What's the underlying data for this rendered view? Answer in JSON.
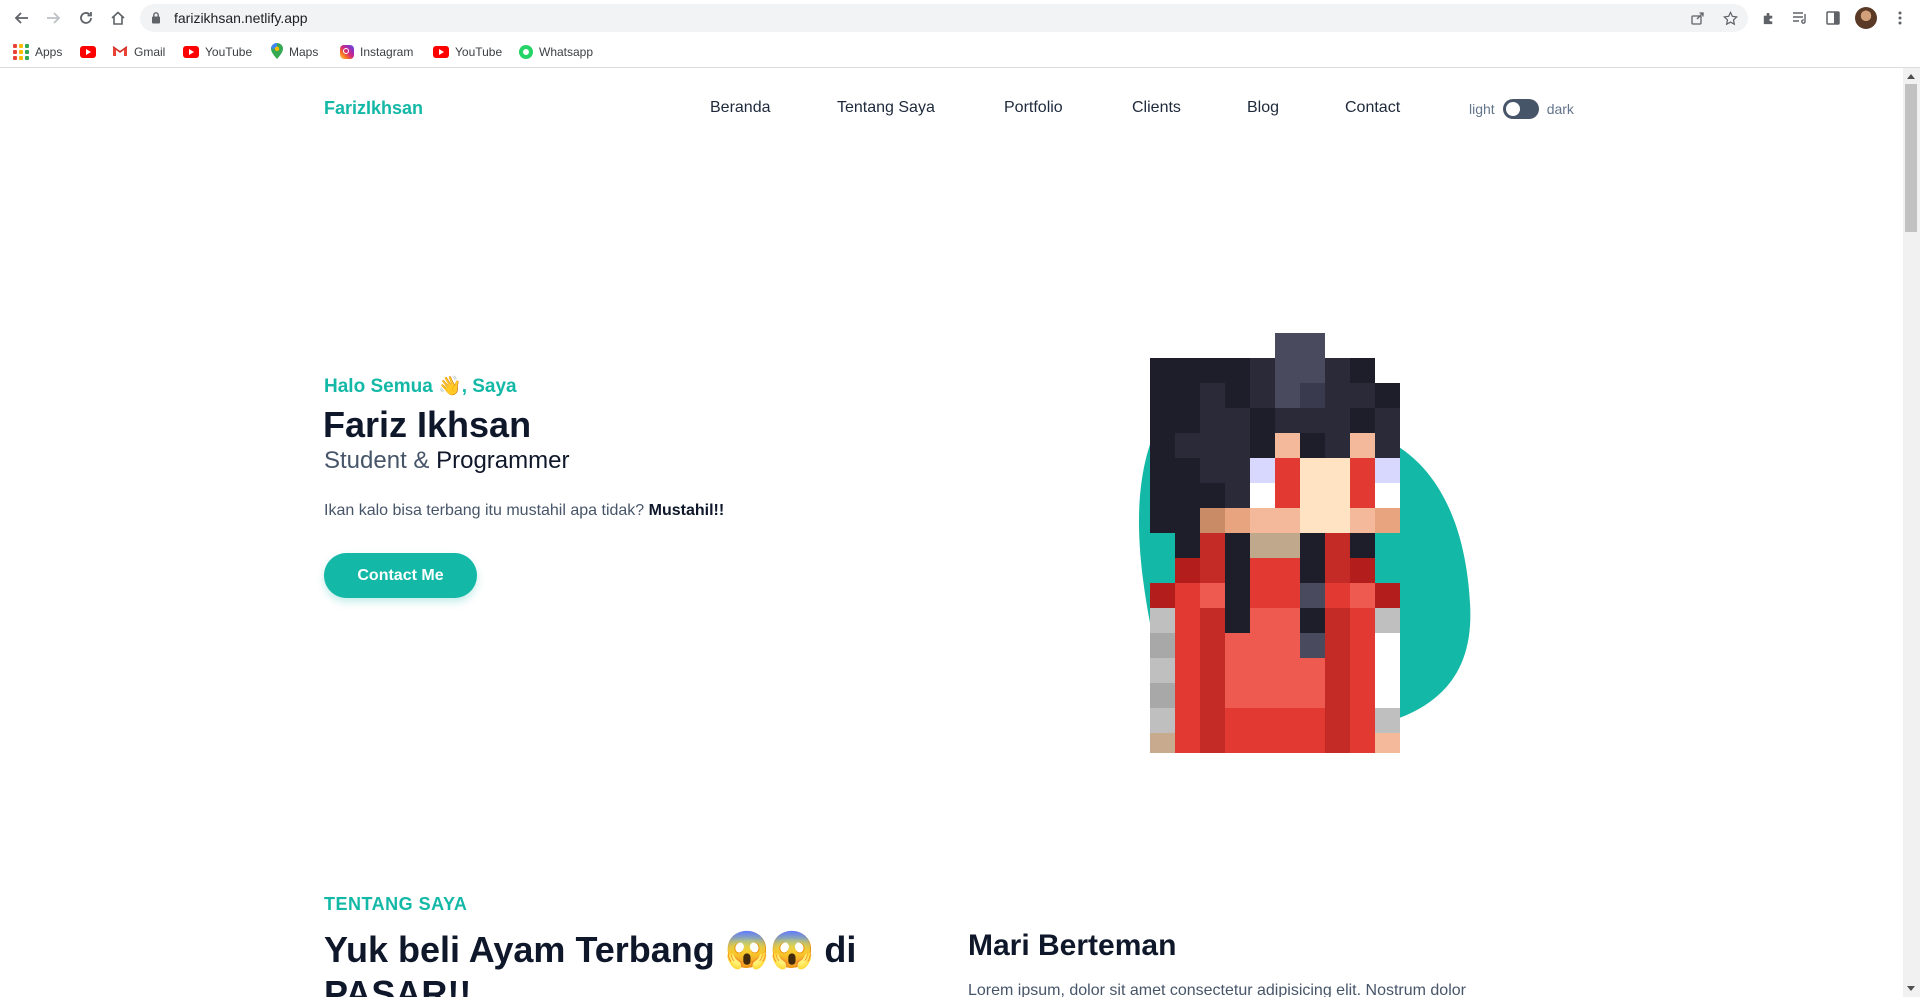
{
  "browser": {
    "url": "farizikhsan.netlify.app",
    "bookmarks": [
      {
        "label": "Apps",
        "icon": "apps-grid-icon"
      },
      {
        "label": "",
        "icon": "youtube-icon"
      },
      {
        "label": "Gmail",
        "icon": "gmail-icon"
      },
      {
        "label": "YouTube",
        "icon": "youtube-icon"
      },
      {
        "label": "Maps",
        "icon": "maps-icon"
      },
      {
        "label": "Instagram",
        "icon": "instagram-icon"
      },
      {
        "label": "YouTube",
        "icon": "youtube-icon"
      },
      {
        "label": "Whatsapp",
        "icon": "whatsapp-icon"
      }
    ]
  },
  "nav": {
    "brand": "FarizIkhsan",
    "items": [
      "Beranda",
      "Tentang Saya",
      "Portfolio",
      "Clients",
      "Blog",
      "Contact"
    ],
    "toggle_light": "light",
    "toggle_dark": "dark"
  },
  "hero": {
    "greeting": "Halo Semua 👋, Saya",
    "name": "Fariz Ikhsan",
    "role_a": "Student &",
    "role_b": "Programmer",
    "desc": "Ikan kalo bisa terbang itu mustahil apa tidak?",
    "desc_bold": "Mustahil!!",
    "cta": "Contact Me"
  },
  "about": {
    "eyebrow": "TENTANG SAYA",
    "title": "Yuk beli Ayam Terbang 😱😱 di PASAR!!",
    "subtitle": "Mari Berteman",
    "text": "Lorem ipsum, dolor sit amet consectetur adipisicing elit. Nostrum dolor"
  },
  "colors": {
    "accent": "#14b8a6",
    "text_dark": "#0f172a",
    "text_muted": "#475569"
  }
}
